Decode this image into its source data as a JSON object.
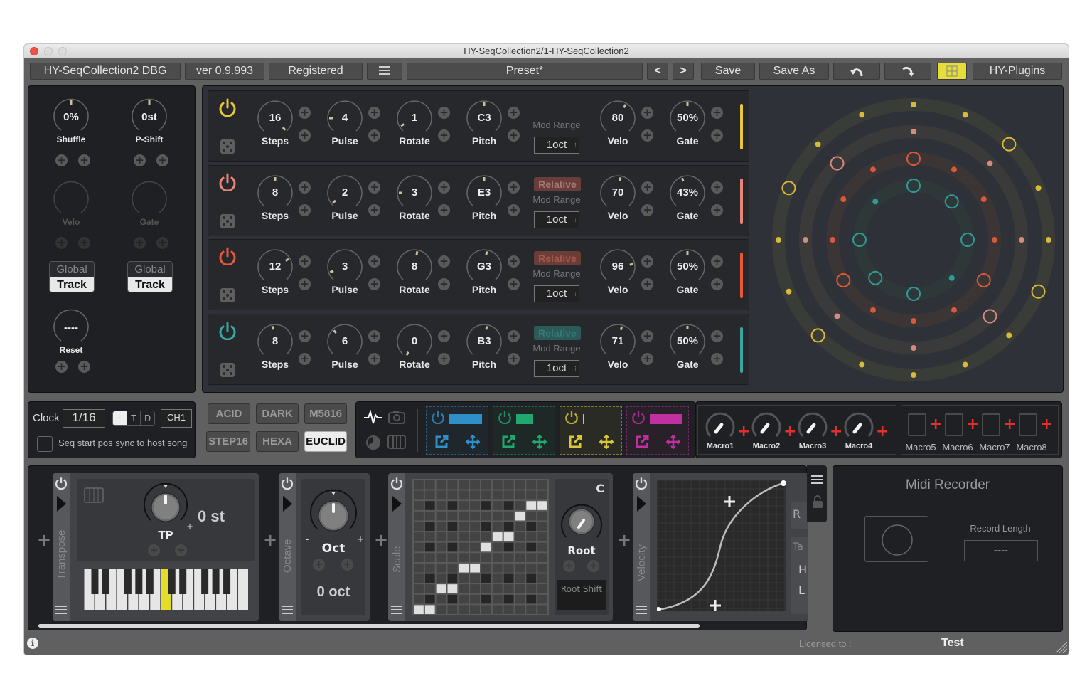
{
  "window": {
    "title": "HY-SeqCollection2/1-HY-SeqCollection2"
  },
  "toolbar": {
    "product": "HY-SeqCollection2 DBG",
    "version": "ver 0.9.993",
    "registered": "Registered",
    "menu_icon": "hamburger-icon",
    "preset": "Preset*",
    "prev": "<",
    "next": ">",
    "save": "Save",
    "save_as": "Save As",
    "undo_icon": "undo-icon",
    "redo_icon": "redo-icon",
    "layout_icon": "layout-icon",
    "brand": "HY-Plugins"
  },
  "global_panel": {
    "shuffle": {
      "value": "0%",
      "label": "Shuffle"
    },
    "pshift": {
      "value": "0st",
      "label": "P-Shift"
    },
    "velo": {
      "label": "Velo"
    },
    "gate": {
      "label": "Gate"
    },
    "toggle1": {
      "global": "Global",
      "track": "Track",
      "selected": "Track"
    },
    "toggle2": {
      "global": "Global",
      "track": "Track",
      "selected": "Track"
    },
    "reset": {
      "value": "----",
      "label": "Reset"
    }
  },
  "tracks": [
    {
      "color": "#e8c53a",
      "enabled": true,
      "steps": "16",
      "pulse": "4",
      "rotate": "1",
      "pitch": "C3",
      "relative": null,
      "mod_range_label": "Mod Range",
      "mod_range": "1oct",
      "velo": "80",
      "gate": "50%"
    },
    {
      "color": "#e8857a",
      "enabled": true,
      "steps": "8",
      "pulse": "2",
      "rotate": "3",
      "pitch": "E3",
      "relative": "Relative",
      "mod_range_label": "Mod Range",
      "mod_range": "1oct",
      "velo": "70",
      "gate": "43%"
    },
    {
      "color": "#e8573a",
      "enabled": true,
      "steps": "12",
      "pulse": "3",
      "rotate": "8",
      "pitch": "G3",
      "relative": "Relative",
      "mod_range_label": "Mod Range",
      "mod_range": "1oct",
      "velo": "96",
      "gate": "50%"
    },
    {
      "color": "#3aa6a0",
      "enabled": true,
      "steps": "8",
      "pulse": "6",
      "rotate": "0",
      "pitch": "B3",
      "relative": "Relative",
      "mod_range_label": "Mod Range",
      "mod_range": "1oct",
      "velo": "71",
      "gate": "50%"
    }
  ],
  "knob_labels": {
    "steps": "Steps",
    "pulse": "Pulse",
    "rotate": "Rotate",
    "pitch": "Pitch",
    "velo": "Velo",
    "gate": "Gate"
  },
  "circle_view": {
    "rings": [
      {
        "track": 1,
        "steps": 16,
        "hits": [
          2,
          5,
          10,
          13
        ],
        "color": "#d9b93a"
      },
      {
        "track": 2,
        "steps": 8,
        "hits": [
          7,
          3
        ],
        "color": "#d98a80"
      },
      {
        "track": 3,
        "steps": 12,
        "hits": [
          0,
          4,
          8
        ],
        "color": "#d9593a"
      },
      {
        "track": 4,
        "steps": 8,
        "hits": [
          0,
          1,
          2,
          4,
          5,
          6
        ],
        "color": "#2f9c97"
      }
    ]
  },
  "clock": {
    "label": "Clock",
    "division": "1/16",
    "modes": [
      "-",
      "T",
      "D"
    ],
    "mode_selected": "-",
    "channel": "CH1",
    "sync_label": "Seq start pos sync to host song",
    "sync_checked": false
  },
  "presets": {
    "buttons": [
      "ACID",
      "DARK",
      "M5816",
      "STEP16",
      "HEXA",
      "EUCLID"
    ],
    "selected": "EUCLID"
  },
  "slots": [
    {
      "color": "#2f8fc8",
      "fill": 0.95
    },
    {
      "color": "#1fa870",
      "fill": 0.5
    },
    {
      "color": "#d9c83a",
      "fill": 0.02
    },
    {
      "color": "#c030a0",
      "fill": 0.95
    }
  ],
  "macros": {
    "knobs": [
      "Macro1",
      "Macro2",
      "Macro3",
      "Macro4"
    ],
    "slots": [
      "Macro5",
      "Macro6",
      "Macro7",
      "Macro8"
    ]
  },
  "modules": {
    "transpose": {
      "name": "Transpose",
      "knob": "TP",
      "value": "0 st",
      "minus": "-",
      "plus": "+"
    },
    "octave": {
      "name": "Octave",
      "knob": "Oct",
      "value": "0 oct",
      "minus": "-",
      "plus": "+"
    },
    "scale": {
      "name": "Scale",
      "root_note": "C",
      "knob": "Root",
      "root_shift": "Root Shift",
      "grid_cols": 12,
      "grid_rows": 13,
      "active": [
        [
          12,
          0
        ],
        [
          12,
          1
        ],
        [
          10,
          2
        ],
        [
          10,
          3
        ],
        [
          8,
          4
        ],
        [
          8,
          5
        ],
        [
          6,
          7
        ],
        [
          5,
          8
        ],
        [
          5,
          9
        ],
        [
          3,
          10
        ],
        [
          2,
          11
        ],
        [
          0,
          11
        ]
      ]
    },
    "velocity": {
      "name": "Velocity"
    },
    "partial": {
      "r": "R",
      "ta": "Ta",
      "h": "H",
      "l": "L"
    }
  },
  "midi_recorder": {
    "title": "Midi Recorder",
    "record_length_label": "Record Length",
    "record_length": "----"
  },
  "footer": {
    "licensed_label": "Licensed to :",
    "licensed_to": "Test"
  }
}
